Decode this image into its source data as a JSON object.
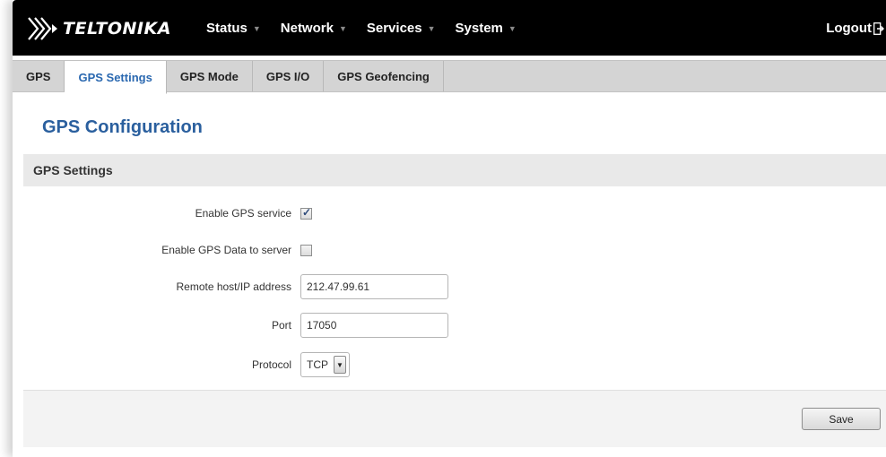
{
  "brand": {
    "name": "TELTONIKA",
    "logo_icon": "teltonika-chevrons-logo"
  },
  "nav": {
    "items": [
      {
        "label": "Status",
        "caret": "▼"
      },
      {
        "label": "Network",
        "caret": "▼"
      },
      {
        "label": "Services",
        "caret": "▼"
      },
      {
        "label": "System",
        "caret": "▼"
      }
    ],
    "logout_label": "Logout",
    "logout_icon": "logout-arrow-icon"
  },
  "tabs": [
    {
      "label": "GPS",
      "active": false
    },
    {
      "label": "GPS Settings",
      "active": true
    },
    {
      "label": "GPS Mode",
      "active": false
    },
    {
      "label": "GPS I/O",
      "active": false
    },
    {
      "label": "GPS Geofencing",
      "active": false
    }
  ],
  "page": {
    "title": "GPS Configuration"
  },
  "section": {
    "title": "GPS Settings"
  },
  "form": {
    "enable_gps_service": {
      "label": "Enable GPS service",
      "checked": true
    },
    "enable_gps_data_to_server": {
      "label": "Enable GPS Data to server",
      "checked": false
    },
    "remote_host": {
      "label": "Remote host/IP address",
      "value": "212.47.99.61"
    },
    "port": {
      "label": "Port",
      "value": "17050"
    },
    "protocol": {
      "label": "Protocol",
      "value": "TCP",
      "caret": "▼"
    }
  },
  "footer": {
    "save_label": "Save"
  },
  "colors": {
    "topbar": "#000000",
    "accent_blue": "#2a5f9e",
    "tab_active_text": "#2a68b0",
    "tabbar": "#d4d4d4",
    "section_bg": "#e9e9e9"
  }
}
